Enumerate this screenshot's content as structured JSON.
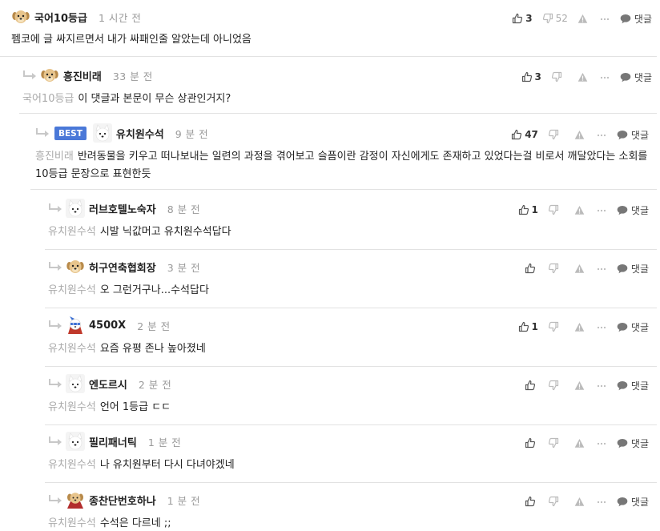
{
  "comments": [
    {
      "nick": "국어10등급",
      "time": "1 시간 전",
      "mention": "",
      "text": "펨코에 글 싸지르면서 내가 싸패인줄 알았는데 아니었음",
      "up": "3",
      "down": "52",
      "reply": "댓글",
      "avatar": "puppy",
      "best": false
    },
    {
      "nick": "흥진비래",
      "time": "33 분 전",
      "mention": "국어10등급",
      "text": "이 댓글과 본문이 무슨 상관인거지?",
      "up": "3",
      "down": "",
      "reply": "댓글",
      "avatar": "puppy",
      "best": false
    },
    {
      "nick": "유치원수석",
      "time": "9 분 전",
      "mention": "흥진비래",
      "text": "반려동물을 키우고 떠나보내는 일련의 과정을 겪어보고 슬픔이란 감정이 자신에게도 존재하고 있었다는걸 비로서 깨달았다는 소회를 10등급 문장으로 표현한듯",
      "up": "47",
      "down": "",
      "reply": "댓글",
      "avatar": "white",
      "best": true,
      "best_label": "BEST"
    },
    {
      "nick": "러브호텔노숙자",
      "time": "8 분 전",
      "mention": "유치원수석",
      "text": "시발 닉값머고 유치원수석답다",
      "up": "1",
      "down": "",
      "reply": "댓글",
      "avatar": "white",
      "best": false
    },
    {
      "nick": "허구연축협회장",
      "time": "3 분 전",
      "mention": "유치원수석",
      "text": "오 그런거구나...수석답다",
      "up": "",
      "down": "",
      "reply": "댓글",
      "avatar": "puppy",
      "best": false
    },
    {
      "nick": "4500X",
      "time": "2 분 전",
      "mention": "유치원수석",
      "text": "요즘 유평 존나 높아졌네",
      "up": "1",
      "down": "",
      "reply": "댓글",
      "avatar": "hero",
      "best": false
    },
    {
      "nick": "엔도르시",
      "time": "2 분 전",
      "mention": "유치원수석",
      "text": "언어 1등급 ㄷㄷ",
      "up": "",
      "down": "",
      "reply": "댓글",
      "avatar": "white",
      "best": false
    },
    {
      "nick": "필리패너틱",
      "time": "1 분 전",
      "mention": "유치원수석",
      "text": "나 유치원부터 다시 다녀야겠네",
      "up": "",
      "down": "",
      "reply": "댓글",
      "avatar": "white",
      "best": false
    },
    {
      "nick": "종찬단번호하나",
      "time": "1 분 전",
      "mention": "유치원수석",
      "text": "수석은 다르네 ;;",
      "up": "",
      "down": "",
      "reply": "댓글",
      "avatar": "red",
      "best": false
    }
  ],
  "colors": {
    "best": "#4a78d8",
    "mention": "#aaaaaa",
    "time": "#999999",
    "divider": "#e2e2e2"
  },
  "icons": {
    "reply_arrow": "reply-arrow-icon",
    "up": "thumbs-up-icon",
    "down": "thumbs-down-icon",
    "report": "warning-icon",
    "more": "more-icon",
    "reply": "speech-bubble-icon"
  }
}
